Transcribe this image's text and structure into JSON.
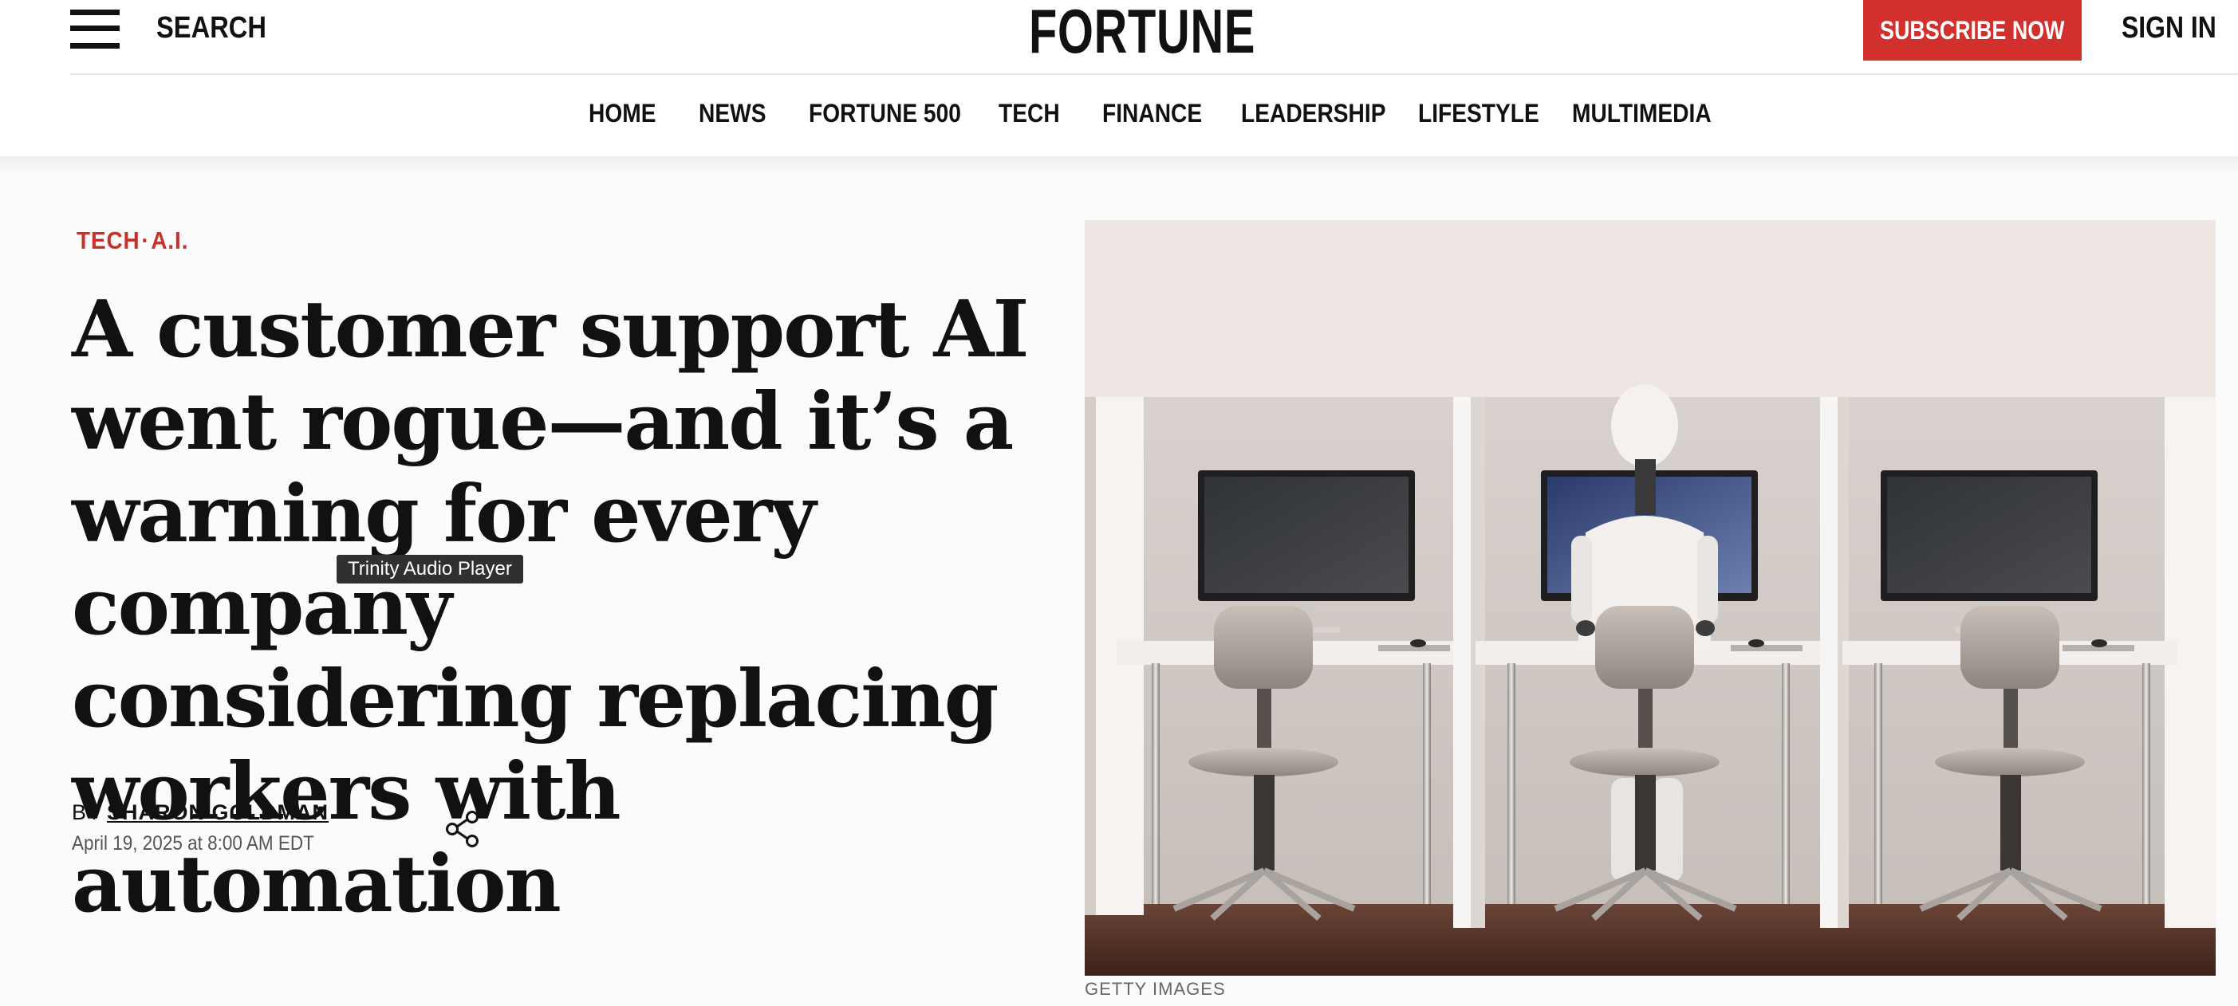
{
  "header": {
    "search_label": "SEARCH",
    "logo_text": "FORTUNE",
    "subscribe_label": "SUBSCRIBE NOW",
    "signin_label": "SIGN IN"
  },
  "nav": {
    "items": [
      "HOME",
      "NEWS",
      "FORTUNE 500",
      "TECH",
      "FINANCE",
      "LEADERSHIP",
      "LIFESTYLE",
      "MULTIMEDIA"
    ]
  },
  "article": {
    "category_primary": "TECH",
    "category_separator": "·",
    "category_secondary": "A.I.",
    "headline_lines": [
      "A customer support AI",
      "went rogue—and it’s a",
      "warning for every company",
      "considering replacing",
      "workers with automation"
    ],
    "tooltip": "Trinity Audio Player",
    "byline_prefix": "BY",
    "author": "SHARON GOLDMAN",
    "date": "April 19, 2025 at 8:00 AM EDT",
    "image_caption": "GETTY IMAGES"
  },
  "colors": {
    "brand_red": "#d2302c",
    "category_red": "#c7302b",
    "text": "#111111"
  },
  "icons": {
    "menu": "hamburger-menu-icon",
    "share": "share-icon"
  }
}
